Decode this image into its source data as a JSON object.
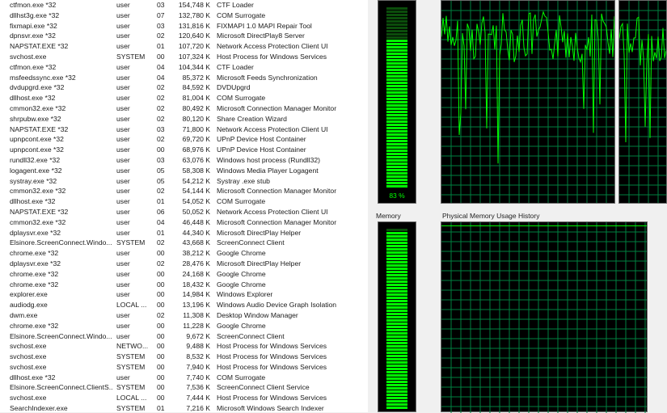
{
  "processes": [
    {
      "name": "ctfmon.exe *32",
      "user": "user",
      "cpu": "03",
      "mem": "154,748 K",
      "desc": "CTF Loader"
    },
    {
      "name": "dllhst3g.exe *32",
      "user": "user",
      "cpu": "07",
      "mem": "132,780 K",
      "desc": "COM Surrogate"
    },
    {
      "name": "fixmapi.exe *32",
      "user": "user",
      "cpu": "03",
      "mem": "131,816 K",
      "desc": "FIXMAPI 1.0 MAPI Repair Tool"
    },
    {
      "name": "dpnsvr.exe *32",
      "user": "user",
      "cpu": "02",
      "mem": "120,640 K",
      "desc": "Microsoft DirectPlay8 Server"
    },
    {
      "name": "NAPSTAT.EXE *32",
      "user": "user",
      "cpu": "01",
      "mem": "107,720 K",
      "desc": "Network Access Protection Client UI"
    },
    {
      "name": "svchost.exe",
      "user": "SYSTEM",
      "cpu": "00",
      "mem": "107,324 K",
      "desc": "Host Process for Windows Services"
    },
    {
      "name": "ctfmon.exe *32",
      "user": "user",
      "cpu": "04",
      "mem": "104,344 K",
      "desc": "CTF Loader"
    },
    {
      "name": "msfeedssync.exe *32",
      "user": "user",
      "cpu": "04",
      "mem": "85,372 K",
      "desc": "Microsoft Feeds Synchronization"
    },
    {
      "name": "dvdupgrd.exe *32",
      "user": "user",
      "cpu": "02",
      "mem": "84,592 K",
      "desc": "DVDUpgrd"
    },
    {
      "name": "dllhost.exe *32",
      "user": "user",
      "cpu": "02",
      "mem": "81,004 K",
      "desc": "COM Surrogate"
    },
    {
      "name": "cmmon32.exe *32",
      "user": "user",
      "cpu": "02",
      "mem": "80,492 K",
      "desc": "Microsoft Connection Manager Monitor"
    },
    {
      "name": "shrpubw.exe *32",
      "user": "user",
      "cpu": "02",
      "mem": "80,120 K",
      "desc": "Share Creation Wizard"
    },
    {
      "name": "NAPSTAT.EXE *32",
      "user": "user",
      "cpu": "03",
      "mem": "71,800 K",
      "desc": "Network Access Protection Client UI"
    },
    {
      "name": "upnpcont.exe *32",
      "user": "user",
      "cpu": "02",
      "mem": "69,720 K",
      "desc": "UPnP Device Host Container"
    },
    {
      "name": "upnpcont.exe *32",
      "user": "user",
      "cpu": "00",
      "mem": "68,976 K",
      "desc": "UPnP Device Host Container"
    },
    {
      "name": "rundll32.exe *32",
      "user": "user",
      "cpu": "03",
      "mem": "63,076 K",
      "desc": "Windows host process (Rundll32)"
    },
    {
      "name": "logagent.exe *32",
      "user": "user",
      "cpu": "05",
      "mem": "58,308 K",
      "desc": "Windows Media Player Logagent"
    },
    {
      "name": "systray.exe *32",
      "user": "user",
      "cpu": "05",
      "mem": "54,212 K",
      "desc": "Systray .exe stub"
    },
    {
      "name": "cmmon32.exe *32",
      "user": "user",
      "cpu": "02",
      "mem": "54,144 K",
      "desc": "Microsoft Connection Manager Monitor"
    },
    {
      "name": "dllhost.exe *32",
      "user": "user",
      "cpu": "01",
      "mem": "54,052 K",
      "desc": "COM Surrogate"
    },
    {
      "name": "NAPSTAT.EXE *32",
      "user": "user",
      "cpu": "06",
      "mem": "50,052 K",
      "desc": "Network Access Protection Client UI"
    },
    {
      "name": "cmmon32.exe *32",
      "user": "user",
      "cpu": "04",
      "mem": "46,448 K",
      "desc": "Microsoft Connection Manager Monitor"
    },
    {
      "name": "dplaysvr.exe *32",
      "user": "user",
      "cpu": "01",
      "mem": "44,340 K",
      "desc": "Microsoft DirectPlay Helper"
    },
    {
      "name": "Elsinore.ScreenConnect.Windo...",
      "user": "SYSTEM",
      "cpu": "02",
      "mem": "43,668 K",
      "desc": "ScreenConnect Client"
    },
    {
      "name": "chrome.exe *32",
      "user": "user",
      "cpu": "00",
      "mem": "38,212 K",
      "desc": "Google Chrome"
    },
    {
      "name": "dplaysvr.exe *32",
      "user": "user",
      "cpu": "02",
      "mem": "28,476 K",
      "desc": "Microsoft DirectPlay Helper"
    },
    {
      "name": "chrome.exe *32",
      "user": "user",
      "cpu": "00",
      "mem": "24,168 K",
      "desc": "Google Chrome"
    },
    {
      "name": "chrome.exe *32",
      "user": "user",
      "cpu": "00",
      "mem": "18,432 K",
      "desc": "Google Chrome"
    },
    {
      "name": "explorer.exe",
      "user": "user",
      "cpu": "00",
      "mem": "14,984 K",
      "desc": "Windows Explorer"
    },
    {
      "name": "audiodg.exe",
      "user": "LOCAL ...",
      "cpu": "00",
      "mem": "13,196 K",
      "desc": "Windows Audio Device Graph Isolation"
    },
    {
      "name": "dwm.exe",
      "user": "user",
      "cpu": "02",
      "mem": "11,308 K",
      "desc": "Desktop Window Manager"
    },
    {
      "name": "chrome.exe *32",
      "user": "user",
      "cpu": "00",
      "mem": "11,228 K",
      "desc": "Google Chrome"
    },
    {
      "name": "Elsinore.ScreenConnect.Windo...",
      "user": "user",
      "cpu": "00",
      "mem": "9,672 K",
      "desc": "ScreenConnect Client"
    },
    {
      "name": "svchost.exe",
      "user": "NETWO...",
      "cpu": "00",
      "mem": "9,488 K",
      "desc": "Host Process for Windows Services"
    },
    {
      "name": "svchost.exe",
      "user": "SYSTEM",
      "cpu": "00",
      "mem": "8,532 K",
      "desc": "Host Process for Windows Services"
    },
    {
      "name": "svchost.exe",
      "user": "SYSTEM",
      "cpu": "00",
      "mem": "7,940 K",
      "desc": "Host Process for Windows Services"
    },
    {
      "name": "dllhost.exe *32",
      "user": "user",
      "cpu": "00",
      "mem": "7,740 K",
      "desc": "COM Surrogate"
    },
    {
      "name": "Elsinore.ScreenConnect.ClientS...",
      "user": "SYSTEM",
      "cpu": "00",
      "mem": "7,536 K",
      "desc": "ScreenConnect Client Service"
    },
    {
      "name": "svchost.exe",
      "user": "LOCAL ...",
      "cpu": "00",
      "mem": "7,444 K",
      "desc": "Host Process for Windows Services"
    },
    {
      "name": "SearchIndexer.exe",
      "user": "SYSTEM",
      "cpu": "01",
      "mem": "7,216 K",
      "desc": "Microsoft Windows Search Indexer"
    }
  ],
  "performance": {
    "cpu_usage_text": "83 %",
    "cpu_usage_level": 0.83,
    "memory_label": "Memory",
    "memory_history_label": "Physical Memory Usage History",
    "memory_usage_level": 0.99,
    "cpu_history_cores": 2,
    "colors": {
      "graph_bg": "#000000",
      "grid": "#008040",
      "meter_on": "#00ff00",
      "line": "#00ff00"
    }
  }
}
